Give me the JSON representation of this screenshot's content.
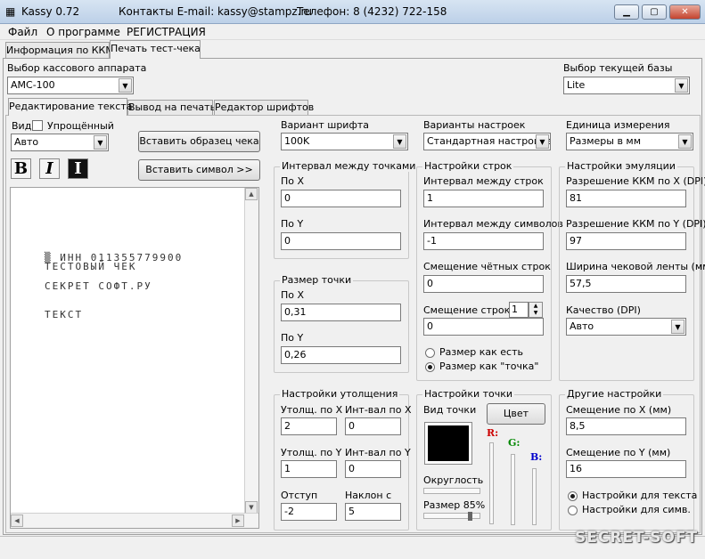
{
  "window": {
    "title": "Kassy 0.72",
    "contacts": "Контакты E-mail: kassy@stampz.ru",
    "phone": "Телефон: 8 (4232) 722-158"
  },
  "menu": [
    "Файл",
    "О программе",
    "РЕГИСТРАЦИЯ"
  ],
  "top_tabs": [
    "Информация по ККМ",
    "Печать тест-чека"
  ],
  "device": {
    "label": "Выбор кассового аппарата",
    "value": "АМС-100"
  },
  "database": {
    "label": "Выбор текущей базы",
    "value": "Lite"
  },
  "sub_tabs": [
    "Редактирование текста",
    "Вывод на печать",
    "Редактор шрифтов"
  ],
  "editor": {
    "view_label": "Вид",
    "simplified_label": "Упрощённый",
    "view_value": "Авто",
    "insert_sample_button": "Вставить образец чека",
    "insert_symbol_button": "Вставить символ >>",
    "format_buttons": [
      "B",
      "I",
      "I"
    ],
    "receipt_lines": [
      "▒ ИНН 011355779900",
      "ТЕСТОВЫЙ ЧЕК",
      "СЕКРЕТ СОФТ.РУ",
      "ТЕКСТ"
    ]
  },
  "font": {
    "label": "Вариант шрифта",
    "value": "100K"
  },
  "presets": {
    "label": "Варианты настроек",
    "value": "Стандартная настройка"
  },
  "units": {
    "label": "Единица измерения",
    "value": "Размеры в мм"
  },
  "point_interval": {
    "caption": "Интервал между точками",
    "x_label": "По X",
    "x_value": "0",
    "y_label": "По Y",
    "y_value": "0"
  },
  "point_size": {
    "caption": "Размер точки",
    "x_label": "По X",
    "x_value": "0,31",
    "y_label": "По Y",
    "y_value": "0,26"
  },
  "line_settings": {
    "caption": "Настройки строк",
    "line_interval_label": "Интервал между строк",
    "line_interval_value": "1",
    "char_interval_label": "Интервал между символов",
    "char_interval_value": "-1",
    "even_offset_label": "Смещение чётных строк",
    "even_offset_value": "0",
    "line_offset_label": "Смещение строки",
    "line_offset_spin": "1",
    "line_offset_value": "0",
    "radio_asis": "Размер как есть",
    "radio_dot": "Размер как \"точка\""
  },
  "emulation": {
    "caption": "Настройки эмуляции",
    "res_x_label": "Разрешение ККМ по X (DPI)",
    "res_x_value": "81",
    "res_y_label": "Разрешение ККМ по Y (DPI)",
    "res_y_value": "97",
    "tape_width_label": "Ширина чековой ленты (мм)",
    "tape_width_value": "57,5",
    "quality_label": "Качество (DPI)",
    "quality_value": "Авто"
  },
  "thickening": {
    "caption": "Настройки утолщения",
    "tx_label": "Утолщ. по X",
    "tx_value": "2",
    "ix_label": "Инт-вал по X",
    "ix_value": "0",
    "ty_label": "Утолщ. по Y",
    "ty_value": "1",
    "iy_label": "Инт-вал по Y",
    "iy_value": "0",
    "indent_label": "Отступ",
    "indent_value": "-2",
    "slant_label": "Наклон с",
    "slant_value": "5"
  },
  "point_settings": {
    "caption": "Настройки точки",
    "view_label": "Вид точки",
    "color_button": "Цвет",
    "roundness_label": "Округлость",
    "size_label": "Размер 85%",
    "size_percent": 85,
    "r_label": "R:",
    "g_label": "G:",
    "b_label": "B:",
    "swatch_color": "#000000",
    "r_color": "#cc0000",
    "g_color": "#008800",
    "b_color": "#0000cc"
  },
  "other": {
    "caption": "Другие настройки",
    "off_x_label": "Смещение по X (мм)",
    "off_x_value": "8,5",
    "off_y_label": "Смещение по Y (мм)",
    "off_y_value": "16",
    "radio_text": "Настройки для текста",
    "radio_symbol": "Настройки для симв."
  },
  "watermark": "SECRET-SOFT"
}
